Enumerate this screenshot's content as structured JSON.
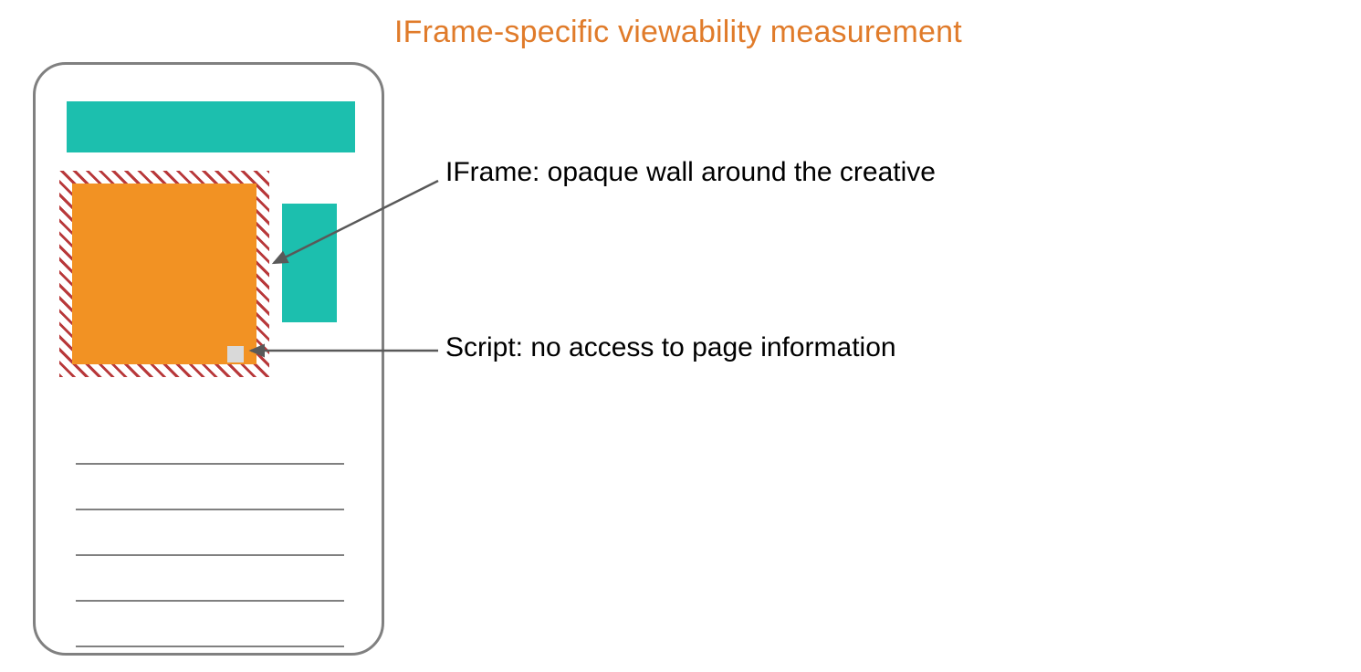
{
  "title": {
    "text": "IFrame-specific viewability measurement",
    "color": "#e07b2a"
  },
  "annotations": {
    "iframe": "IFrame: opaque wall around the creative",
    "script": "Script: no access to page information"
  },
  "colors": {
    "teal": "#1cbfae",
    "orange": "#f29223",
    "hatch": "#b8383a",
    "scriptDot": "#d9d9d9",
    "frame": "#808080",
    "arrow": "#595959"
  },
  "layout": {
    "textLineYs": [
      436,
      486,
      536,
      586,
      636
    ]
  }
}
